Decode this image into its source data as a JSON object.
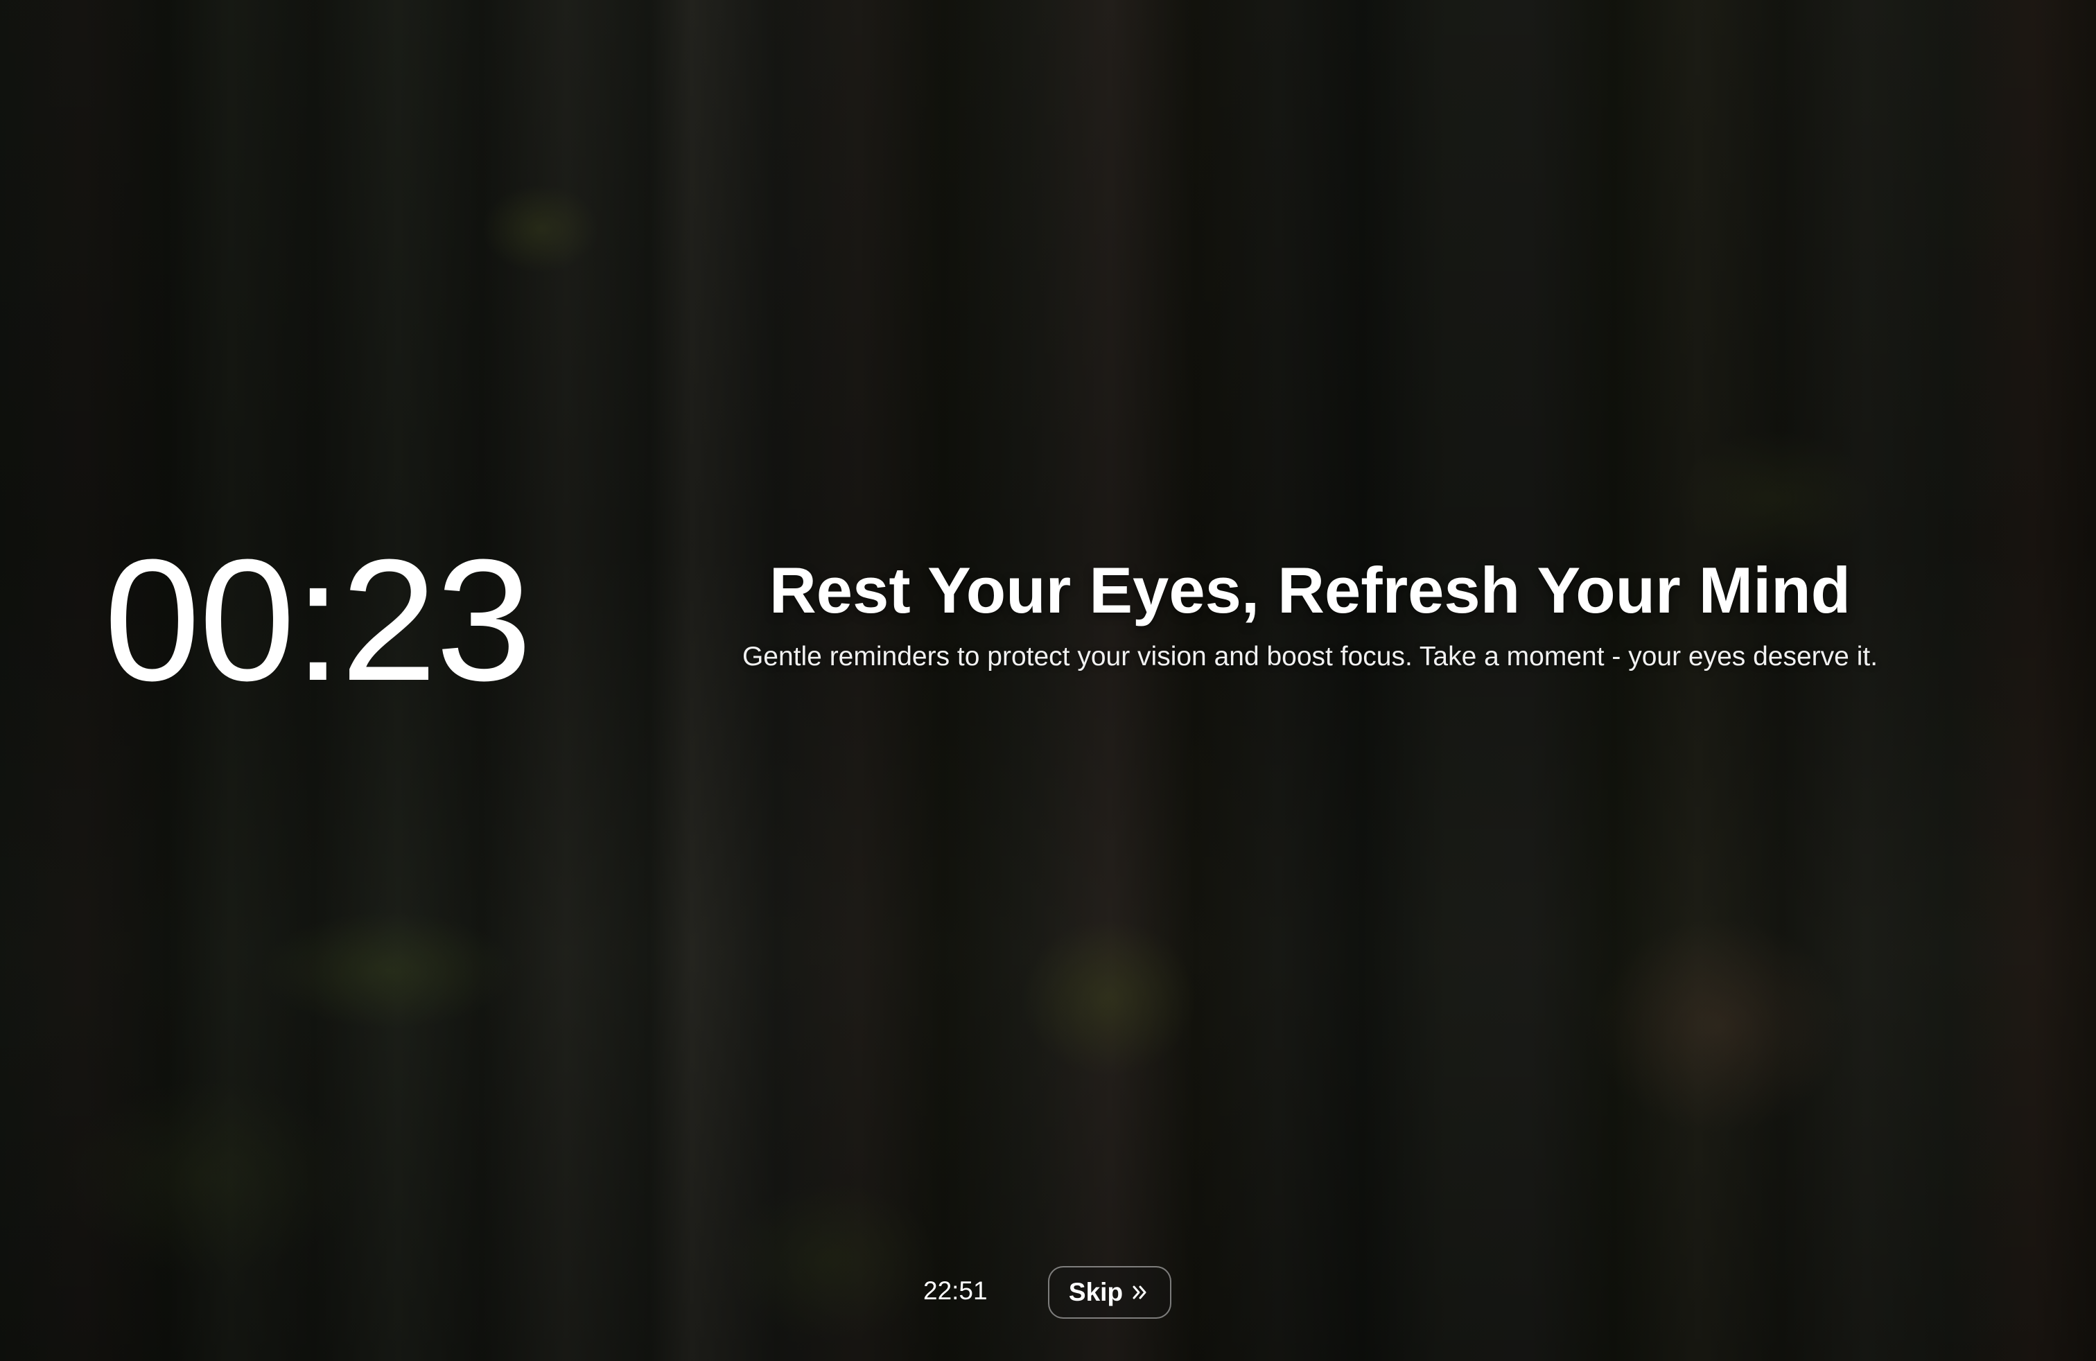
{
  "break_screen": {
    "countdown": "00:23",
    "headline": "Rest Your Eyes, Refresh Your Mind",
    "subtitle": "Gentle reminders to protect your vision and boost focus. Take a moment - your eyes deserve it.",
    "current_time": "22:51",
    "skip_label": "Skip",
    "skip_icon": "double-chevron-right-icon"
  },
  "colors": {
    "text": "#ffffff",
    "button_border": "#8a8a8a"
  }
}
